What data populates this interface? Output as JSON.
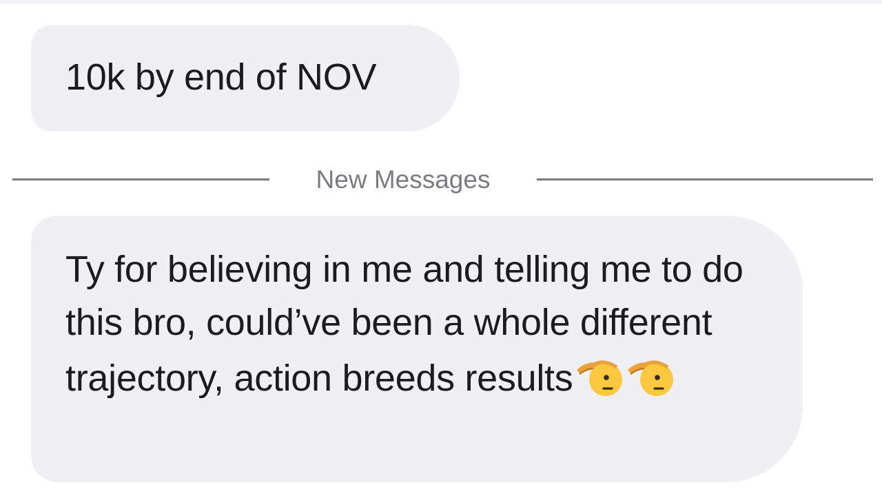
{
  "thread": {
    "messages": [
      {
        "text": "10k by end of NOV"
      },
      {
        "text": "Ty for believing in me and telling me to do this bro, could’ve been a whole different trajectory, action breeds results",
        "emoji": [
          "saluting-face-emoji",
          "saluting-face-emoji"
        ]
      }
    ],
    "divider_label": "New Messages"
  },
  "colors": {
    "bubble": "#f0f0f3",
    "text": "#1c1c1e",
    "divider": "#7a7a80",
    "background": "#ffffff"
  }
}
